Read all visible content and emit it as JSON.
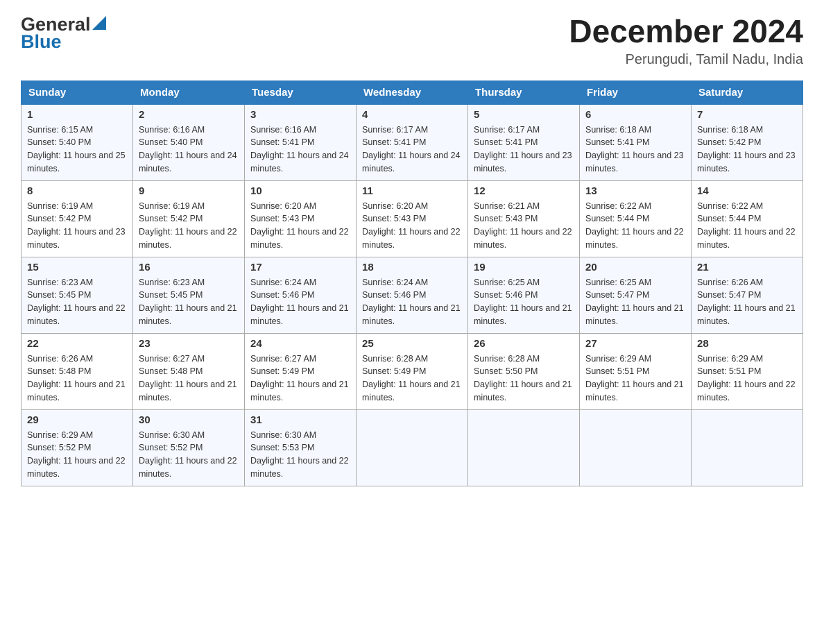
{
  "header": {
    "logo_general": "General",
    "logo_blue": "Blue",
    "month_year": "December 2024",
    "location": "Perungudi, Tamil Nadu, India"
  },
  "days_of_week": [
    "Sunday",
    "Monday",
    "Tuesday",
    "Wednesday",
    "Thursday",
    "Friday",
    "Saturday"
  ],
  "weeks": [
    [
      {
        "day": "1",
        "sunrise": "6:15 AM",
        "sunset": "5:40 PM",
        "daylight": "11 hours and 25 minutes."
      },
      {
        "day": "2",
        "sunrise": "6:16 AM",
        "sunset": "5:40 PM",
        "daylight": "11 hours and 24 minutes."
      },
      {
        "day": "3",
        "sunrise": "6:16 AM",
        "sunset": "5:41 PM",
        "daylight": "11 hours and 24 minutes."
      },
      {
        "day": "4",
        "sunrise": "6:17 AM",
        "sunset": "5:41 PM",
        "daylight": "11 hours and 24 minutes."
      },
      {
        "day": "5",
        "sunrise": "6:17 AM",
        "sunset": "5:41 PM",
        "daylight": "11 hours and 23 minutes."
      },
      {
        "day": "6",
        "sunrise": "6:18 AM",
        "sunset": "5:41 PM",
        "daylight": "11 hours and 23 minutes."
      },
      {
        "day": "7",
        "sunrise": "6:18 AM",
        "sunset": "5:42 PM",
        "daylight": "11 hours and 23 minutes."
      }
    ],
    [
      {
        "day": "8",
        "sunrise": "6:19 AM",
        "sunset": "5:42 PM",
        "daylight": "11 hours and 23 minutes."
      },
      {
        "day": "9",
        "sunrise": "6:19 AM",
        "sunset": "5:42 PM",
        "daylight": "11 hours and 22 minutes."
      },
      {
        "day": "10",
        "sunrise": "6:20 AM",
        "sunset": "5:43 PM",
        "daylight": "11 hours and 22 minutes."
      },
      {
        "day": "11",
        "sunrise": "6:20 AM",
        "sunset": "5:43 PM",
        "daylight": "11 hours and 22 minutes."
      },
      {
        "day": "12",
        "sunrise": "6:21 AM",
        "sunset": "5:43 PM",
        "daylight": "11 hours and 22 minutes."
      },
      {
        "day": "13",
        "sunrise": "6:22 AM",
        "sunset": "5:44 PM",
        "daylight": "11 hours and 22 minutes."
      },
      {
        "day": "14",
        "sunrise": "6:22 AM",
        "sunset": "5:44 PM",
        "daylight": "11 hours and 22 minutes."
      }
    ],
    [
      {
        "day": "15",
        "sunrise": "6:23 AM",
        "sunset": "5:45 PM",
        "daylight": "11 hours and 22 minutes."
      },
      {
        "day": "16",
        "sunrise": "6:23 AM",
        "sunset": "5:45 PM",
        "daylight": "11 hours and 21 minutes."
      },
      {
        "day": "17",
        "sunrise": "6:24 AM",
        "sunset": "5:46 PM",
        "daylight": "11 hours and 21 minutes."
      },
      {
        "day": "18",
        "sunrise": "6:24 AM",
        "sunset": "5:46 PM",
        "daylight": "11 hours and 21 minutes."
      },
      {
        "day": "19",
        "sunrise": "6:25 AM",
        "sunset": "5:46 PM",
        "daylight": "11 hours and 21 minutes."
      },
      {
        "day": "20",
        "sunrise": "6:25 AM",
        "sunset": "5:47 PM",
        "daylight": "11 hours and 21 minutes."
      },
      {
        "day": "21",
        "sunrise": "6:26 AM",
        "sunset": "5:47 PM",
        "daylight": "11 hours and 21 minutes."
      }
    ],
    [
      {
        "day": "22",
        "sunrise": "6:26 AM",
        "sunset": "5:48 PM",
        "daylight": "11 hours and 21 minutes."
      },
      {
        "day": "23",
        "sunrise": "6:27 AM",
        "sunset": "5:48 PM",
        "daylight": "11 hours and 21 minutes."
      },
      {
        "day": "24",
        "sunrise": "6:27 AM",
        "sunset": "5:49 PM",
        "daylight": "11 hours and 21 minutes."
      },
      {
        "day": "25",
        "sunrise": "6:28 AM",
        "sunset": "5:49 PM",
        "daylight": "11 hours and 21 minutes."
      },
      {
        "day": "26",
        "sunrise": "6:28 AM",
        "sunset": "5:50 PM",
        "daylight": "11 hours and 21 minutes."
      },
      {
        "day": "27",
        "sunrise": "6:29 AM",
        "sunset": "5:51 PM",
        "daylight": "11 hours and 21 minutes."
      },
      {
        "day": "28",
        "sunrise": "6:29 AM",
        "sunset": "5:51 PM",
        "daylight": "11 hours and 22 minutes."
      }
    ],
    [
      {
        "day": "29",
        "sunrise": "6:29 AM",
        "sunset": "5:52 PM",
        "daylight": "11 hours and 22 minutes."
      },
      {
        "day": "30",
        "sunrise": "6:30 AM",
        "sunset": "5:52 PM",
        "daylight": "11 hours and 22 minutes."
      },
      {
        "day": "31",
        "sunrise": "6:30 AM",
        "sunset": "5:53 PM",
        "daylight": "11 hours and 22 minutes."
      },
      null,
      null,
      null,
      null
    ]
  ]
}
